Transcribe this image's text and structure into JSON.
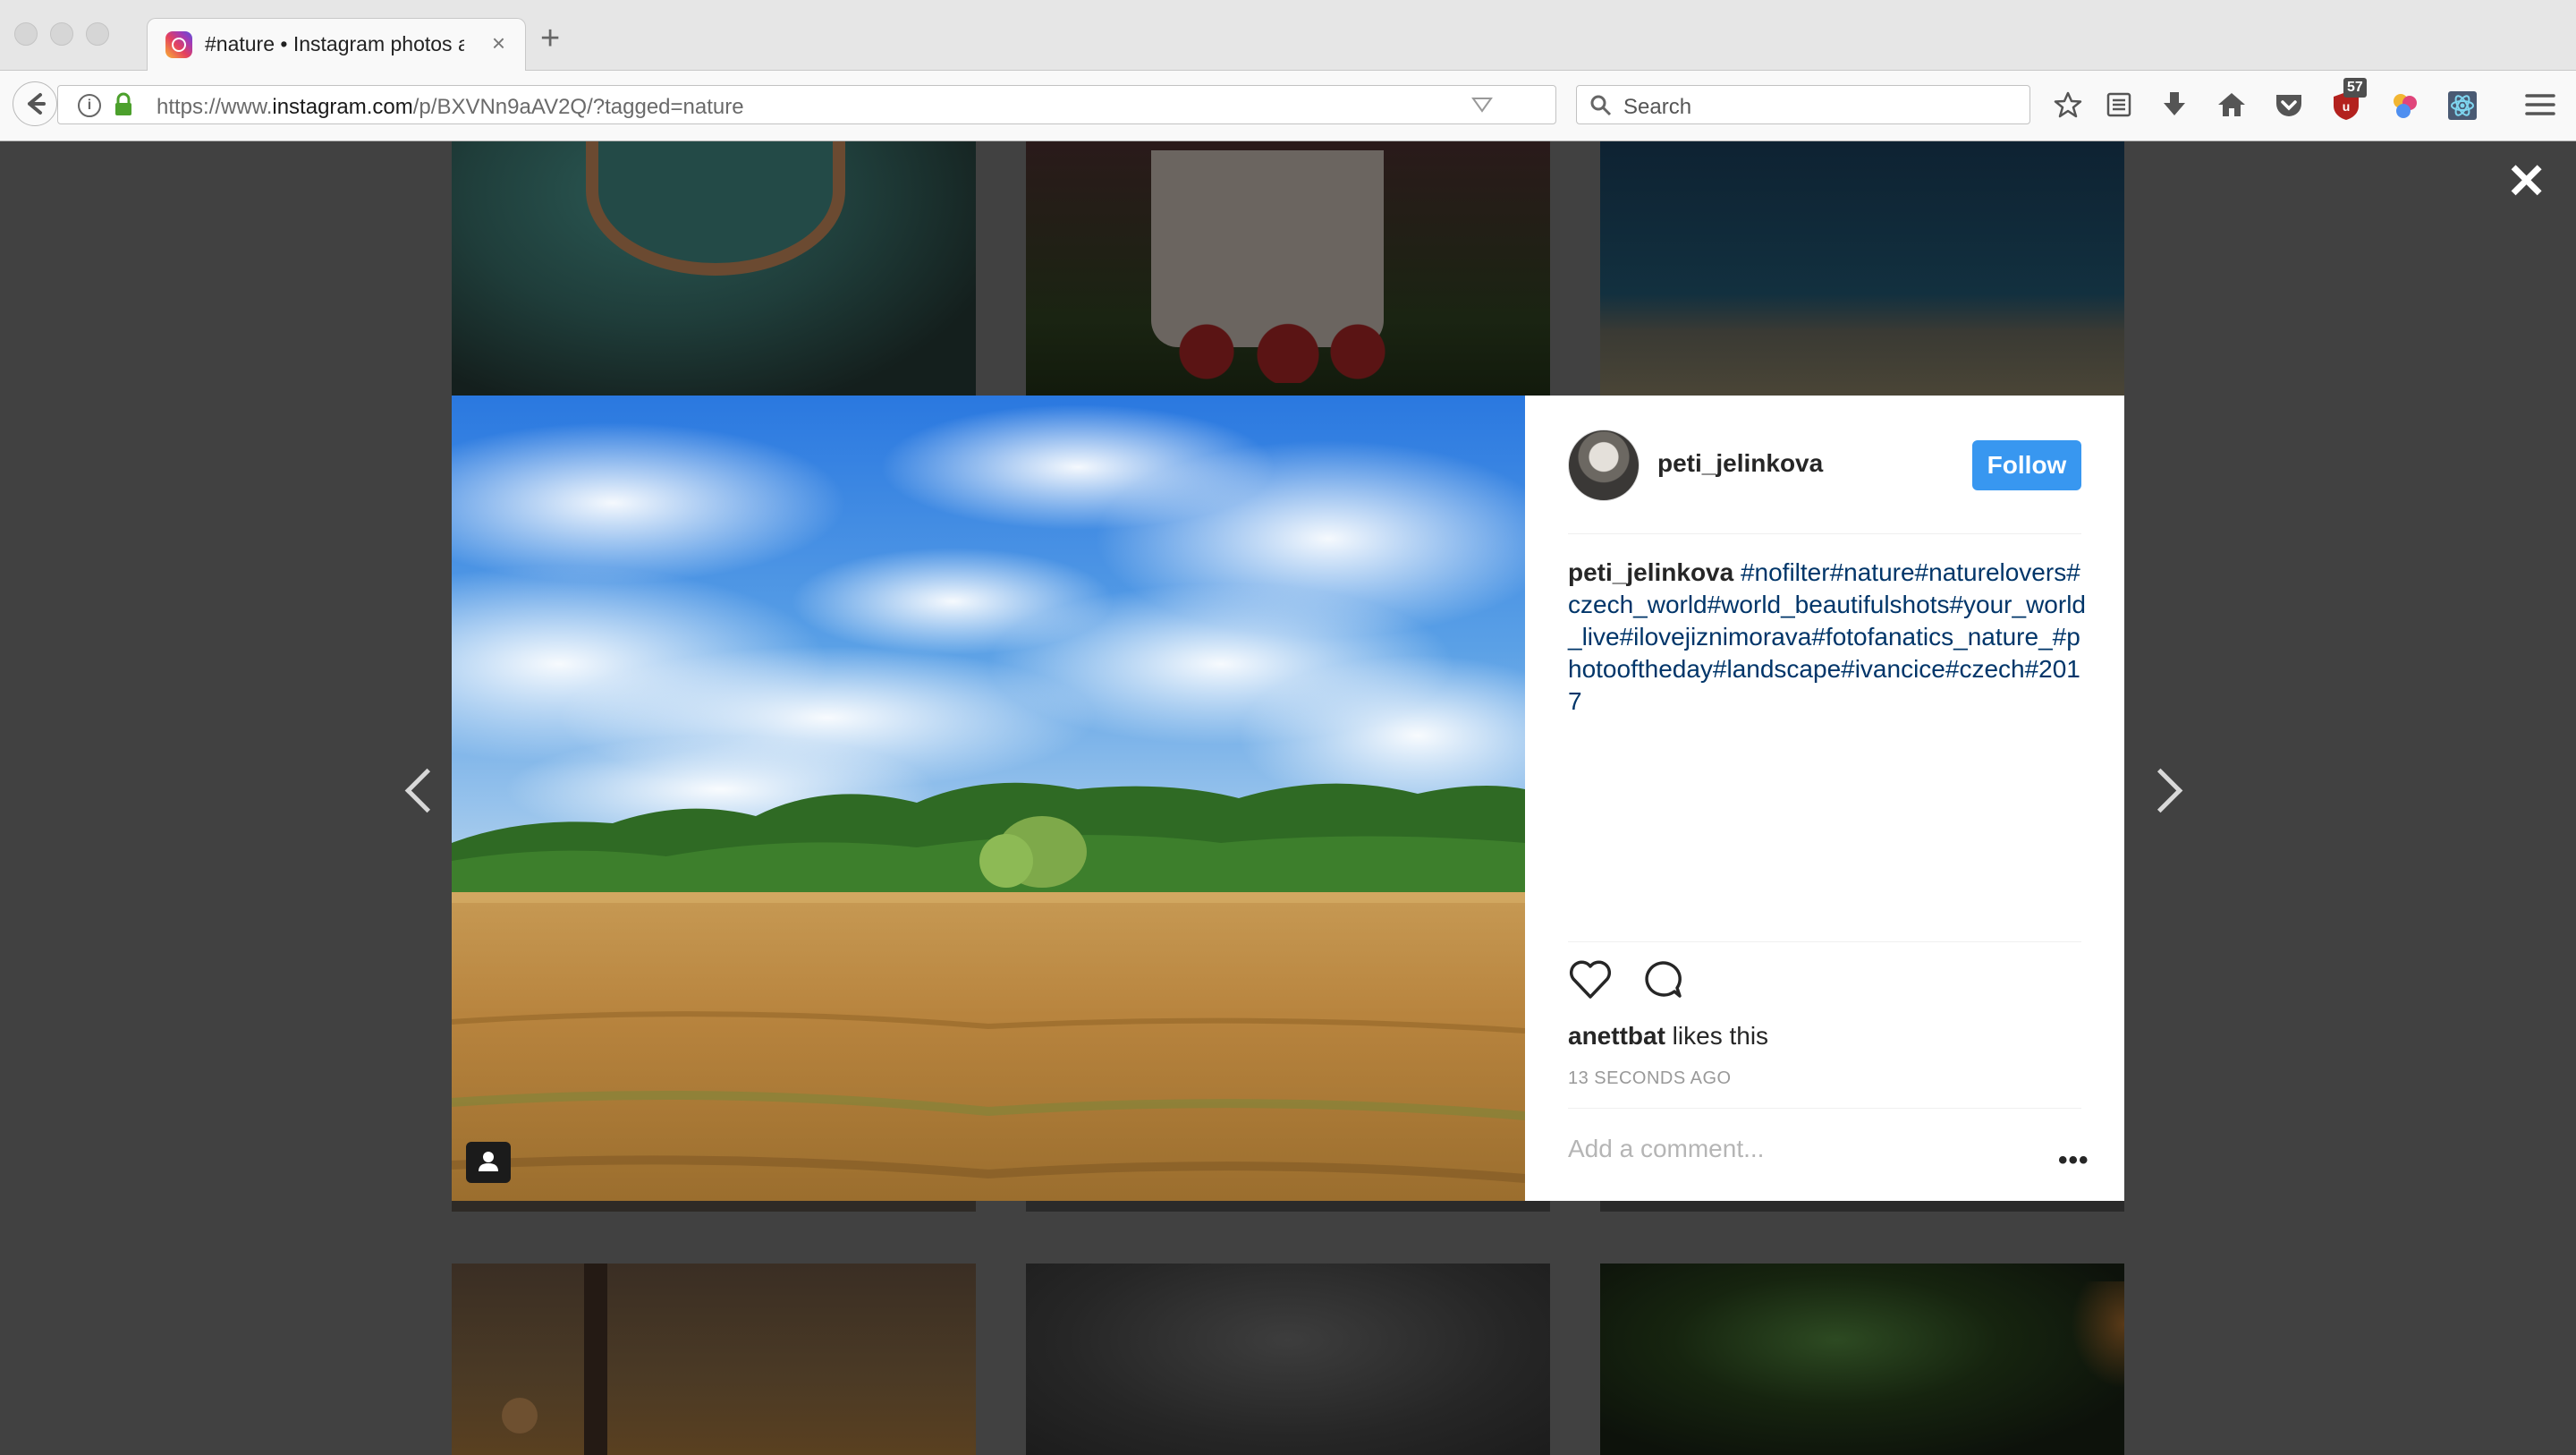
{
  "browser": {
    "tab_title": "#nature • Instagram photos and videos",
    "tab_close": "×",
    "new_tab": "+",
    "url_prefix": "https://www.",
    "url_host": "instagram.com",
    "url_path": "/p/BXVNn9aAV2Q/?tagged=nature",
    "search_placeholder": "Search",
    "ublock_count": "57"
  },
  "modal": {
    "close_glyph": "✕"
  },
  "post": {
    "username": "peti_jelinkova",
    "follow_label": "Follow",
    "caption_user": "peti_jelinkova",
    "caption_tags": "#nofilter#nature#naturelovers#czech_world#world_beautifulshots#your_world_live#ilovejiznimorava#fotofanatics_nature_#photooftheday#landscape#ivancice#czech#2017",
    "liker": "anettbat",
    "likes_suffix": " likes this",
    "timestamp": "13 SECONDS AGO",
    "comment_placeholder": "Add a comment...",
    "more_glyph": "•••"
  },
  "colors": {
    "follow_button": "#3897f0",
    "hashtag": "#003569",
    "overlay": "#414141"
  }
}
